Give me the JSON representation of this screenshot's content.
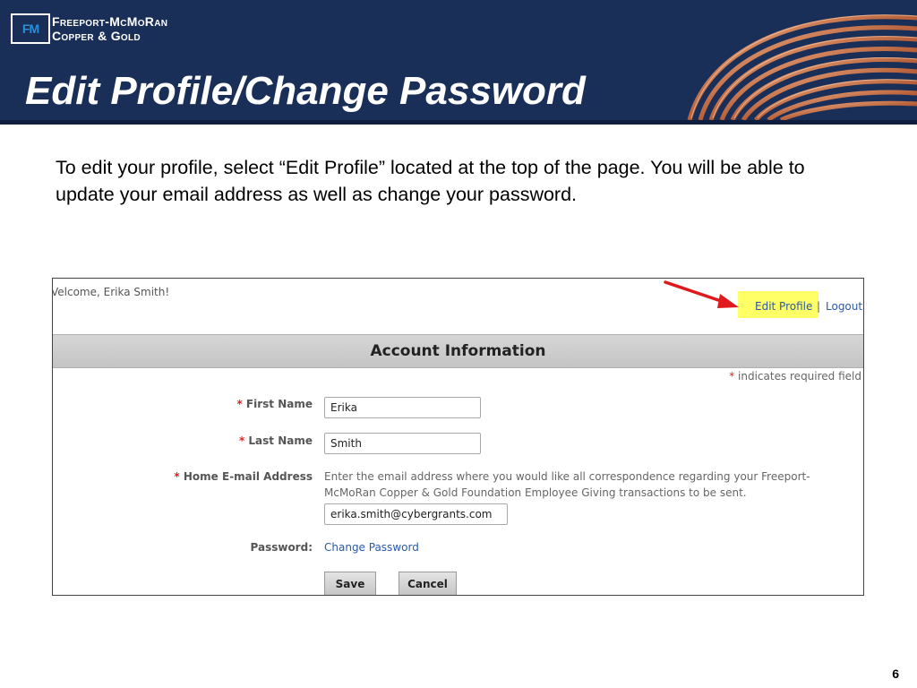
{
  "header": {
    "logo_mark": "FM",
    "company_line1": "Freeport-McMoRan",
    "company_line2": "Copper & Gold",
    "title": "Edit Profile/Change Password",
    "colors": {
      "background": "#1a2f57",
      "title_text": "#ffffff",
      "logo_accent": "#2a8fd6"
    }
  },
  "intro_text": "To edit your profile, select “Edit Profile” located at the top of the page. You will be able to update your email address as well as change your password.",
  "screenshot": {
    "welcome": "Velcome, Erika Smith!",
    "nav": {
      "edit_profile": "Edit Profile",
      "separator": "|",
      "logout": "Logout",
      "highlight_color": "#ffff66",
      "arrow_color": "#e0191e"
    },
    "section_title": "Account Information",
    "required_star": "*",
    "required_note": " indicates required field",
    "fields": {
      "first_name": {
        "label": "First Name",
        "value": "Erika"
      },
      "last_name": {
        "label": "Last Name",
        "value": "Smith"
      },
      "email": {
        "label": "Home E-mail Address",
        "help": "Enter the email address where you would like all correspondence regarding your Freeport-McMoRan Copper & Gold Foundation Employee Giving transactions to be sent.",
        "value": "erika.smith@cybergrants.com"
      },
      "password": {
        "label": "Password:",
        "link": "Change Password"
      }
    },
    "buttons": {
      "save": "Save",
      "cancel": "Cancel"
    },
    "link_color": "#2a5aa6"
  },
  "page_number": "6"
}
